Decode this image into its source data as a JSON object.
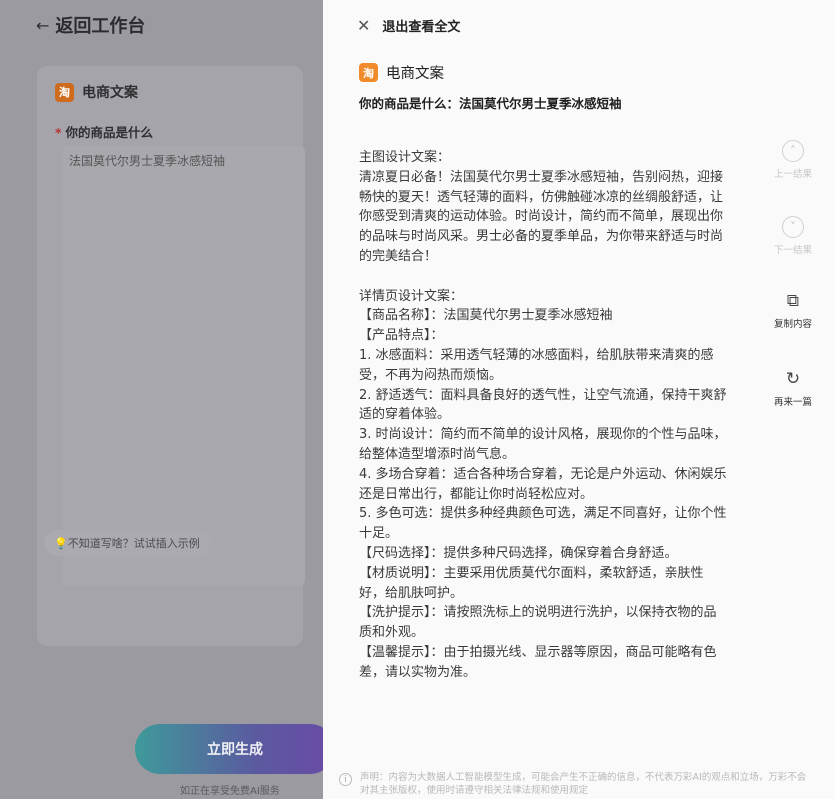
{
  "workspace": {
    "back_label": "返回工作台",
    "card_title": "电商文案",
    "logo_text": "淘",
    "field_label": "你的商品是什么",
    "field_value": "法国莫代尔男士夏季冰感短袖",
    "hint": "💡不知道写啥？试试插入示例",
    "generate_label": "立即生成",
    "generate_sub": "如正在享受免费AI服务"
  },
  "panel": {
    "close_label": "退出查看全文",
    "title": "电商文案",
    "logo_text": "淘",
    "question": "你的商品是什么：法国莫代尔男士夏季冰感短袖",
    "paragraphs": [
      "主图设计文案：",
      "清凉夏日必备！法国莫代尔男士夏季冰感短袖，告别闷热，迎接畅快的夏天！透气轻薄的面料，仿佛触碰冰凉的丝绸般舒适，让你感受到清爽的运动体验。时尚设计，简约而不简单，展现出你的品味与时尚风采。男士必备的夏季单品，为你带来舒适与时尚的完美结合！",
      "",
      "详情页设计文案：",
      "【商品名称】：法国莫代尔男士夏季冰感短袖",
      "【产品特点】：",
      "1. 冰感面料：采用透气轻薄的冰感面料，给肌肤带来清爽的感受，不再为闷热而烦恼。",
      "2. 舒适透气：面料具备良好的透气性，让空气流通，保持干爽舒适的穿着体验。",
      "3. 时尚设计：简约而不简单的设计风格，展现你的个性与品味，给整体造型增添时尚气息。",
      "4. 多场合穿着：适合各种场合穿着，无论是户外运动、休闲娱乐还是日常出行，都能让你时尚轻松应对。",
      "5. 多色可选：提供多种经典颜色可选，满足不同喜好，让你个性十足。",
      "【尺码选择】：提供多种尺码选择，确保穿着合身舒适。",
      "【材质说明】：主要采用优质莫代尔面料，柔软舒适，亲肤性好，给肌肤呵护。",
      "【洗护提示】：请按照洗标上的说明进行洗护，以保持衣物的品质和外观。",
      "【温馨提示】：由于拍摄光线、显示器等原因，商品可能略有色差，请以实物为准。"
    ],
    "actions": {
      "prev": "上一结果",
      "next": "下一结果",
      "copy": "复制内容",
      "regen": "再来一篇"
    },
    "disclaimer": "声明：内容为大数据人工智能模型生成，可能会产生不正确的信息，不代表万彩AI的观点和立场，万彩不会对其主张版权，使用时请遵守相关法律法规和使用规定"
  }
}
